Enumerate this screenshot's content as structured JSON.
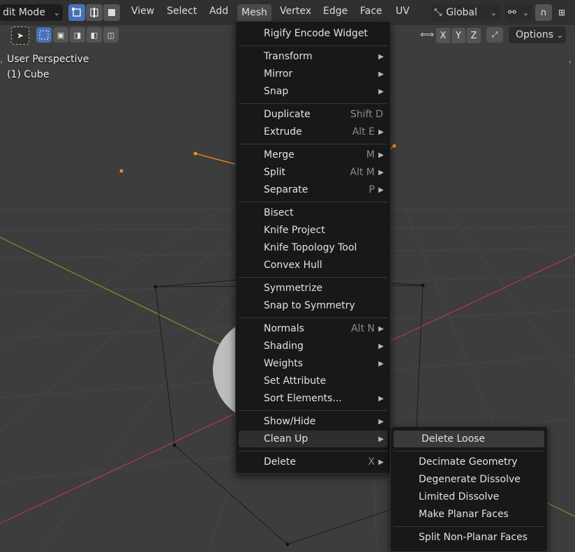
{
  "header": {
    "mode": "dit Mode",
    "menus": [
      "View",
      "Select",
      "Add",
      "Mesh",
      "Vertex",
      "Edge",
      "Face",
      "UV"
    ],
    "orientation": "Global",
    "options_label": "Options",
    "axes": [
      "X",
      "Y",
      "Z"
    ]
  },
  "overlay": {
    "view_name": "User Perspective",
    "object_name": "(1) Cube"
  },
  "mesh_menu": {
    "items": [
      {
        "label": "Rigify Encode Widget",
        "shortcut": "",
        "sub": false
      },
      {
        "label": "Transform",
        "shortcut": "",
        "sub": true
      },
      {
        "label": "Mirror",
        "shortcut": "",
        "sub": true
      },
      {
        "label": "Snap",
        "shortcut": "",
        "sub": true
      },
      {
        "label": "Duplicate",
        "shortcut": "Shift D",
        "sub": false
      },
      {
        "label": "Extrude",
        "shortcut": "Alt E",
        "sub": true
      },
      {
        "label": "Merge",
        "shortcut": "M",
        "sub": true
      },
      {
        "label": "Split",
        "shortcut": "Alt M",
        "sub": true
      },
      {
        "label": "Separate",
        "shortcut": "P",
        "sub": true
      },
      {
        "label": "Bisect",
        "shortcut": "",
        "sub": false
      },
      {
        "label": "Knife Project",
        "shortcut": "",
        "sub": false
      },
      {
        "label": "Knife Topology Tool",
        "shortcut": "",
        "sub": false
      },
      {
        "label": "Convex Hull",
        "shortcut": "",
        "sub": false
      },
      {
        "label": "Symmetrize",
        "shortcut": "",
        "sub": false
      },
      {
        "label": "Snap to Symmetry",
        "shortcut": "",
        "sub": false
      },
      {
        "label": "Normals",
        "shortcut": "Alt N",
        "sub": true
      },
      {
        "label": "Shading",
        "shortcut": "",
        "sub": true
      },
      {
        "label": "Weights",
        "shortcut": "",
        "sub": true
      },
      {
        "label": "Set Attribute",
        "shortcut": "",
        "sub": false
      },
      {
        "label": "Sort Elements...",
        "shortcut": "",
        "sub": true
      },
      {
        "label": "Show/Hide",
        "shortcut": "",
        "sub": true
      },
      {
        "label": "Clean Up",
        "shortcut": "",
        "sub": true
      },
      {
        "label": "Delete",
        "shortcut": "X",
        "sub": true
      }
    ]
  },
  "cleanup_menu": {
    "items": [
      {
        "label": "Delete Loose"
      },
      {
        "label": "Decimate Geometry"
      },
      {
        "label": "Degenerate Dissolve"
      },
      {
        "label": "Limited Dissolve"
      },
      {
        "label": "Make Planar Faces"
      },
      {
        "label": "Split Non-Planar Faces"
      }
    ]
  },
  "colors": {
    "accent": "#4772b3",
    "vertex": "#ff8c1a",
    "x_axis": "#b53a4a",
    "y_axis": "#6e9a2e"
  }
}
